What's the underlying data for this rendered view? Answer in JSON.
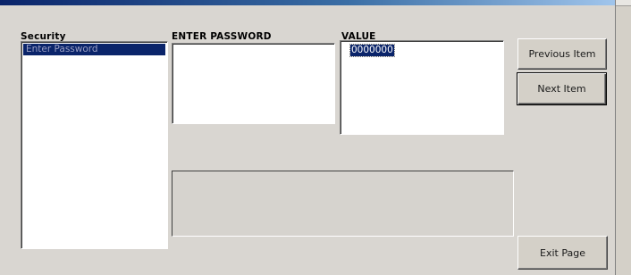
{
  "labels": {
    "security": "Security",
    "enter_password": "ENTER PASSWORD",
    "value": "VALUE"
  },
  "security_list": {
    "items": [
      {
        "label": "Enter Password",
        "selected": true
      }
    ]
  },
  "password_field": {
    "value": ""
  },
  "value_field": {
    "value": "0000000"
  },
  "buttons": {
    "previous": "Previous Item",
    "next": "Next Item",
    "exit": "Exit Page"
  },
  "colors": {
    "window_background": "#d6d3ce",
    "selection": "#0a246a",
    "title_gradient_start": "#0a246a"
  }
}
